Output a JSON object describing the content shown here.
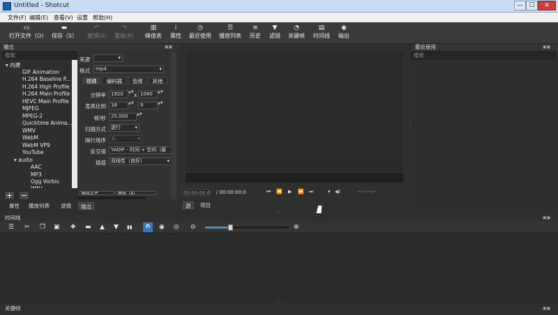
{
  "window": {
    "title": "Untitled - Shotcut",
    "min": "—",
    "max": "☐",
    "close": "✕"
  },
  "menu": [
    "文件(F)",
    "编辑(E)",
    "查看(V)",
    "设置",
    "帮助(H)"
  ],
  "toolbar": [
    {
      "icon": "folder-icon",
      "glyph": "▭",
      "label": "打开文件（O）",
      "enabled": true
    },
    {
      "icon": "save-icon",
      "glyph": "▬",
      "label": "保存（S）",
      "enabled": true
    },
    {
      "icon": "undo-icon",
      "glyph": "↶",
      "label": "撤销(Ⅴ)",
      "enabled": false
    },
    {
      "icon": "redo-icon",
      "glyph": "↷",
      "label": "重做(R)",
      "enabled": false
    },
    {
      "icon": "peak-meter-icon",
      "glyph": "▥",
      "label": "峰值表",
      "enabled": true
    },
    {
      "icon": "info-icon",
      "glyph": "i",
      "label": "属性",
      "enabled": true
    },
    {
      "icon": "clock-icon",
      "glyph": "◷",
      "label": "最近使用",
      "enabled": true
    },
    {
      "icon": "playlist-icon",
      "glyph": "☰",
      "label": "播放列表",
      "enabled": true
    },
    {
      "icon": "history-icon",
      "glyph": "≡",
      "label": "历史",
      "enabled": true
    },
    {
      "icon": "filter-icon",
      "glyph": "▼",
      "label": "滤镜",
      "enabled": true
    },
    {
      "icon": "keyframe-icon",
      "glyph": "◔",
      "label": "关键帧",
      "enabled": true
    },
    {
      "icon": "timeline-icon",
      "glyph": "▤",
      "label": "时间线",
      "enabled": true
    },
    {
      "icon": "export-icon",
      "glyph": "◉",
      "label": "输出",
      "enabled": true
    }
  ],
  "output_panel": {
    "title": "输出",
    "search_placeholder": "搜索",
    "tree": [
      {
        "label": "内建",
        "level": 0,
        "expander": "▾"
      },
      {
        "label": "GIF Animation",
        "level": 1
      },
      {
        "label": "H.264 Baseline P...",
        "level": 1
      },
      {
        "label": "H.264 High Profile",
        "level": 1
      },
      {
        "label": "H.264 Main Profile",
        "level": 1
      },
      {
        "label": "HEVC Main Profile",
        "level": 1
      },
      {
        "label": "MJPEG",
        "level": 1
      },
      {
        "label": "MPEG-2",
        "level": 1
      },
      {
        "label": "Quicktime Anima...",
        "level": 1
      },
      {
        "label": "WMV",
        "level": 1
      },
      {
        "label": "WebM",
        "level": 1
      },
      {
        "label": "WebM VP9",
        "level": 1
      },
      {
        "label": "YouTube",
        "level": 1
      },
      {
        "label": "audio",
        "level": 1,
        "expander": "▾"
      },
      {
        "label": "AAC",
        "level": 2
      },
      {
        "label": "MP3",
        "level": 2
      },
      {
        "label": "Ogg Vorbis",
        "level": 2
      },
      {
        "label": "WAV",
        "level": 2
      }
    ],
    "add_label": "+",
    "remove_label": "−"
  },
  "properties": {
    "from_label": "来源",
    "from_value": "",
    "format_label": "格式",
    "format_value": "mp4",
    "tabs": [
      "视频",
      "编码器",
      "音频",
      "其他"
    ],
    "resolution_label": "分辨率",
    "res_w": "1920",
    "res_x": "x",
    "res_h": "1080",
    "aspect_label": "宽高比例",
    "aspect_w": "16",
    "aspect_h": "9",
    "fps_label": "帧/秒",
    "fps_value": "25.000",
    "scan_label": "扫描方式",
    "scan_value": "逐行",
    "field_label": "隔行场序",
    "field_value": "无",
    "deinterlace_label": "反交错",
    "deinterlace_value": "YADIF - 时间 + 空间（最",
    "interp_label": "插值",
    "interp_value": "双线性（良好）",
    "bottom_btns": [
      "输出文件",
      "高级（A）"
    ]
  },
  "left_tabs": [
    "属性",
    "播放列表",
    "滤镜",
    "输出"
  ],
  "player": {
    "timecode_pos": "00:00:00:0",
    "timecode_dur": "/ 00:00:00:0",
    "controls": [
      "⏮",
      "⏪",
      "▶",
      "⏩",
      "⏭"
    ],
    "volume_glyph": "◀)",
    "in_out": "--:--:--:--",
    "tabs": [
      "源",
      "项目"
    ]
  },
  "recent": {
    "title": "最近使用",
    "search_placeholder": "搜索"
  },
  "timeline": {
    "title": "时间线",
    "tools": [
      {
        "name": "menu-icon",
        "glyph": "☰"
      },
      {
        "name": "cut-icon",
        "glyph": "✂"
      },
      {
        "name": "copy-icon",
        "glyph": "❐"
      },
      {
        "name": "paste-icon",
        "glyph": "▣"
      },
      {
        "name": "append-icon",
        "glyph": "✚"
      },
      {
        "name": "remove-icon",
        "glyph": "▬"
      },
      {
        "name": "lift-icon",
        "glyph": "▲"
      },
      {
        "name": "overwrite-icon",
        "glyph": "▼"
      },
      {
        "name": "split-icon",
        "glyph": "▮▮"
      },
      {
        "name": "snap-icon",
        "glyph": "∩"
      },
      {
        "name": "scrub-icon",
        "glyph": "◉"
      },
      {
        "name": "ripple-icon",
        "glyph": "◎"
      },
      {
        "name": "zoom-out-icon",
        "glyph": "⊖"
      },
      {
        "name": "zoom-in-icon",
        "glyph": "⊕"
      }
    ],
    "zoom_level": 0.3
  },
  "keyframes": {
    "title": "关键帧"
  }
}
